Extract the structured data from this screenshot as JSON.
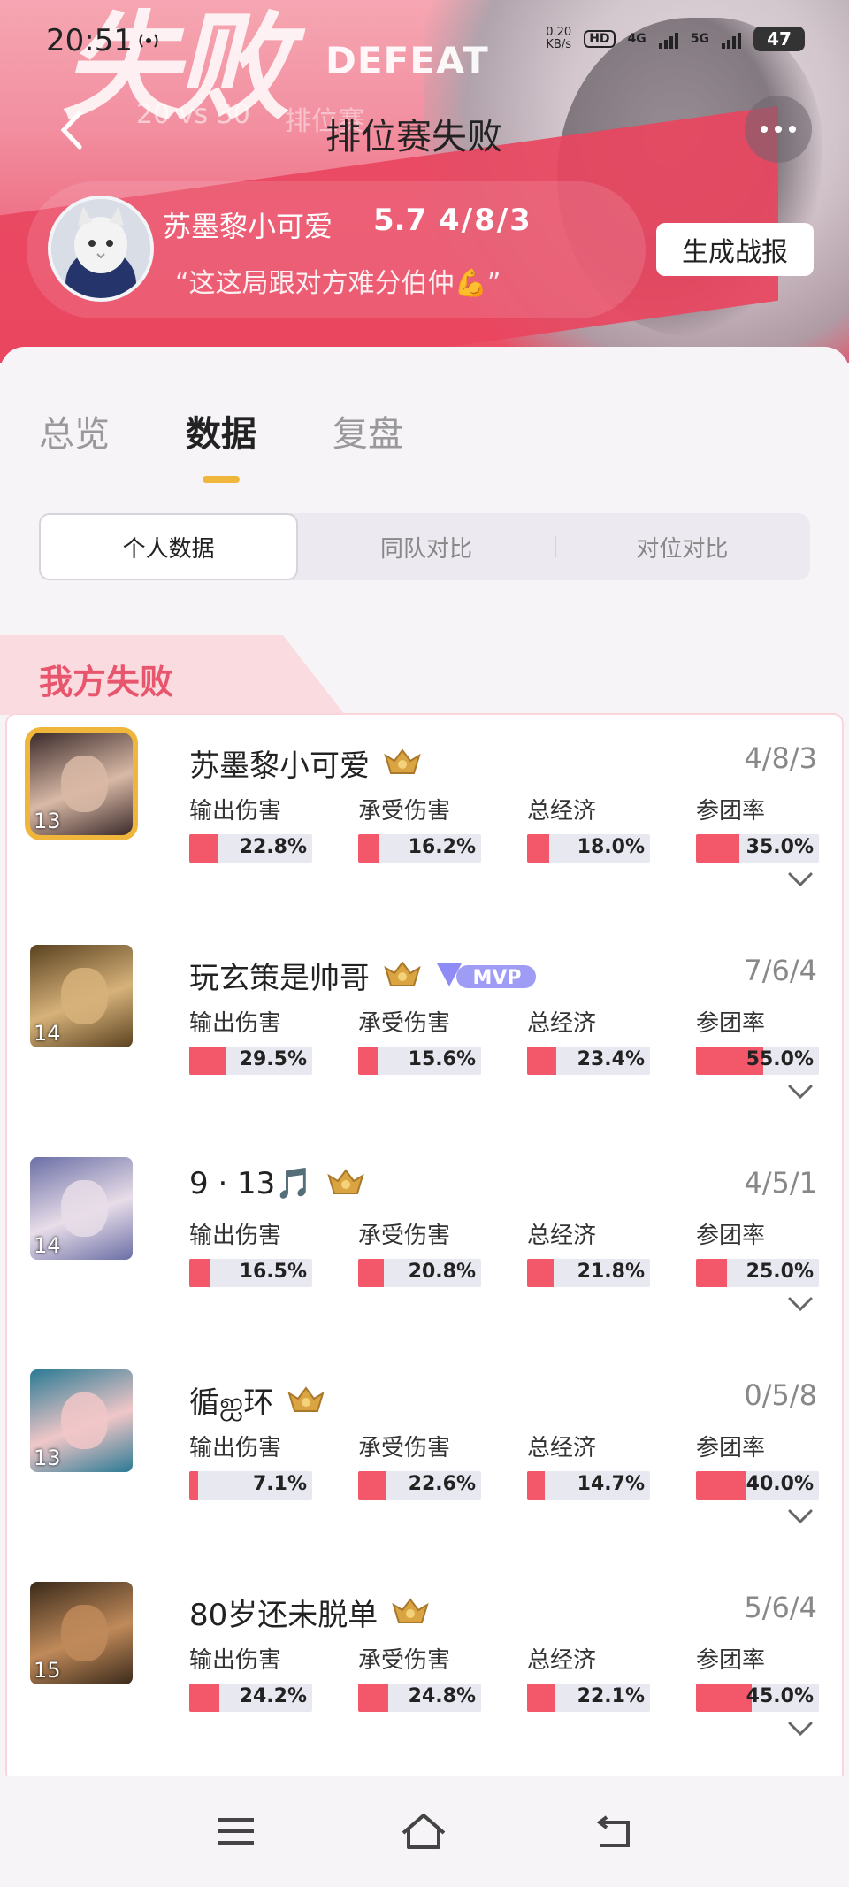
{
  "status_bar": {
    "time": "20:51",
    "speed_value": "0.20",
    "speed_unit": "KB/s",
    "hd_badge": "HD",
    "net1": "4G",
    "net2": "5G",
    "battery": "47"
  },
  "header": {
    "banner_result": "失败",
    "banner_sub": "DEFEAT",
    "vs": "20 vs 30",
    "mode_faded": "排位赛",
    "title": "排位赛失败",
    "report_button": "生成战报"
  },
  "player": {
    "name": "苏墨黎小可爱",
    "score": "5.7",
    "kda": "4/8/3",
    "quote": "“这这局跟对方难分伯仲💪”"
  },
  "tabs": [
    "总览",
    "数据",
    "复盘"
  ],
  "active_tab": "数据",
  "segments": [
    "个人数据",
    "同队对比",
    "对位对比"
  ],
  "section_title": "我方失败",
  "stat_labels": [
    "输出伤害",
    "承受伤害",
    "总经济",
    "参团率"
  ],
  "players": [
    {
      "name": "苏墨黎小可爱",
      "level": "13",
      "kda": "4/8/3",
      "mvp": false,
      "highlight": true,
      "stats": [
        {
          "pct": 22.8,
          "text": "22.8%"
        },
        {
          "pct": 16.2,
          "text": "16.2%"
        },
        {
          "pct": 18.0,
          "text": "18.0%"
        },
        {
          "pct": 35.0,
          "text": "35.0%"
        }
      ],
      "hero_colors": [
        "#3b2a2a",
        "#d9b9a6"
      ]
    },
    {
      "name": "玩玄策是帅哥",
      "level": "14",
      "kda": "7/6/4",
      "mvp": true,
      "mvp_label": "MVP",
      "highlight": false,
      "stats": [
        {
          "pct": 29.5,
          "text": "29.5%"
        },
        {
          "pct": 15.6,
          "text": "15.6%"
        },
        {
          "pct": 23.4,
          "text": "23.4%"
        },
        {
          "pct": 55.0,
          "text": "55.0%"
        }
      ],
      "hero_colors": [
        "#5a4220",
        "#d7b27a"
      ]
    },
    {
      "name": "9 · 13🎵",
      "level": "14",
      "kda": "4/5/1",
      "mvp": false,
      "highlight": false,
      "stats": [
        {
          "pct": 16.5,
          "text": "16.5%"
        },
        {
          "pct": 20.8,
          "text": "20.8%"
        },
        {
          "pct": 21.8,
          "text": "21.8%"
        },
        {
          "pct": 25.0,
          "text": "25.0%"
        }
      ],
      "hero_colors": [
        "#6b6fa6",
        "#e8dde8"
      ]
    },
    {
      "name": "循ஐ环",
      "level": "13",
      "kda": "0/5/8",
      "mvp": false,
      "highlight": false,
      "stats": [
        {
          "pct": 7.1,
          "text": "7.1%"
        },
        {
          "pct": 22.6,
          "text": "22.6%"
        },
        {
          "pct": 14.7,
          "text": "14.7%"
        },
        {
          "pct": 40.0,
          "text": "40.0%"
        }
      ],
      "hero_colors": [
        "#2a7a94",
        "#f1c7c8"
      ]
    },
    {
      "name": "80岁还未脱单",
      "level": "15",
      "kda": "5/6/4",
      "mvp": false,
      "highlight": false,
      "stats": [
        {
          "pct": 24.2,
          "text": "24.2%"
        },
        {
          "pct": 24.8,
          "text": "24.8%"
        },
        {
          "pct": 22.1,
          "text": "22.1%"
        },
        {
          "pct": 45.0,
          "text": "45.0%"
        }
      ],
      "hero_colors": [
        "#3a2a1a",
        "#c08a5a"
      ]
    }
  ],
  "colors": {
    "accent_red": "#f2576a",
    "tab_indicator": "#f0b63b",
    "section_text": "#e8566e"
  }
}
